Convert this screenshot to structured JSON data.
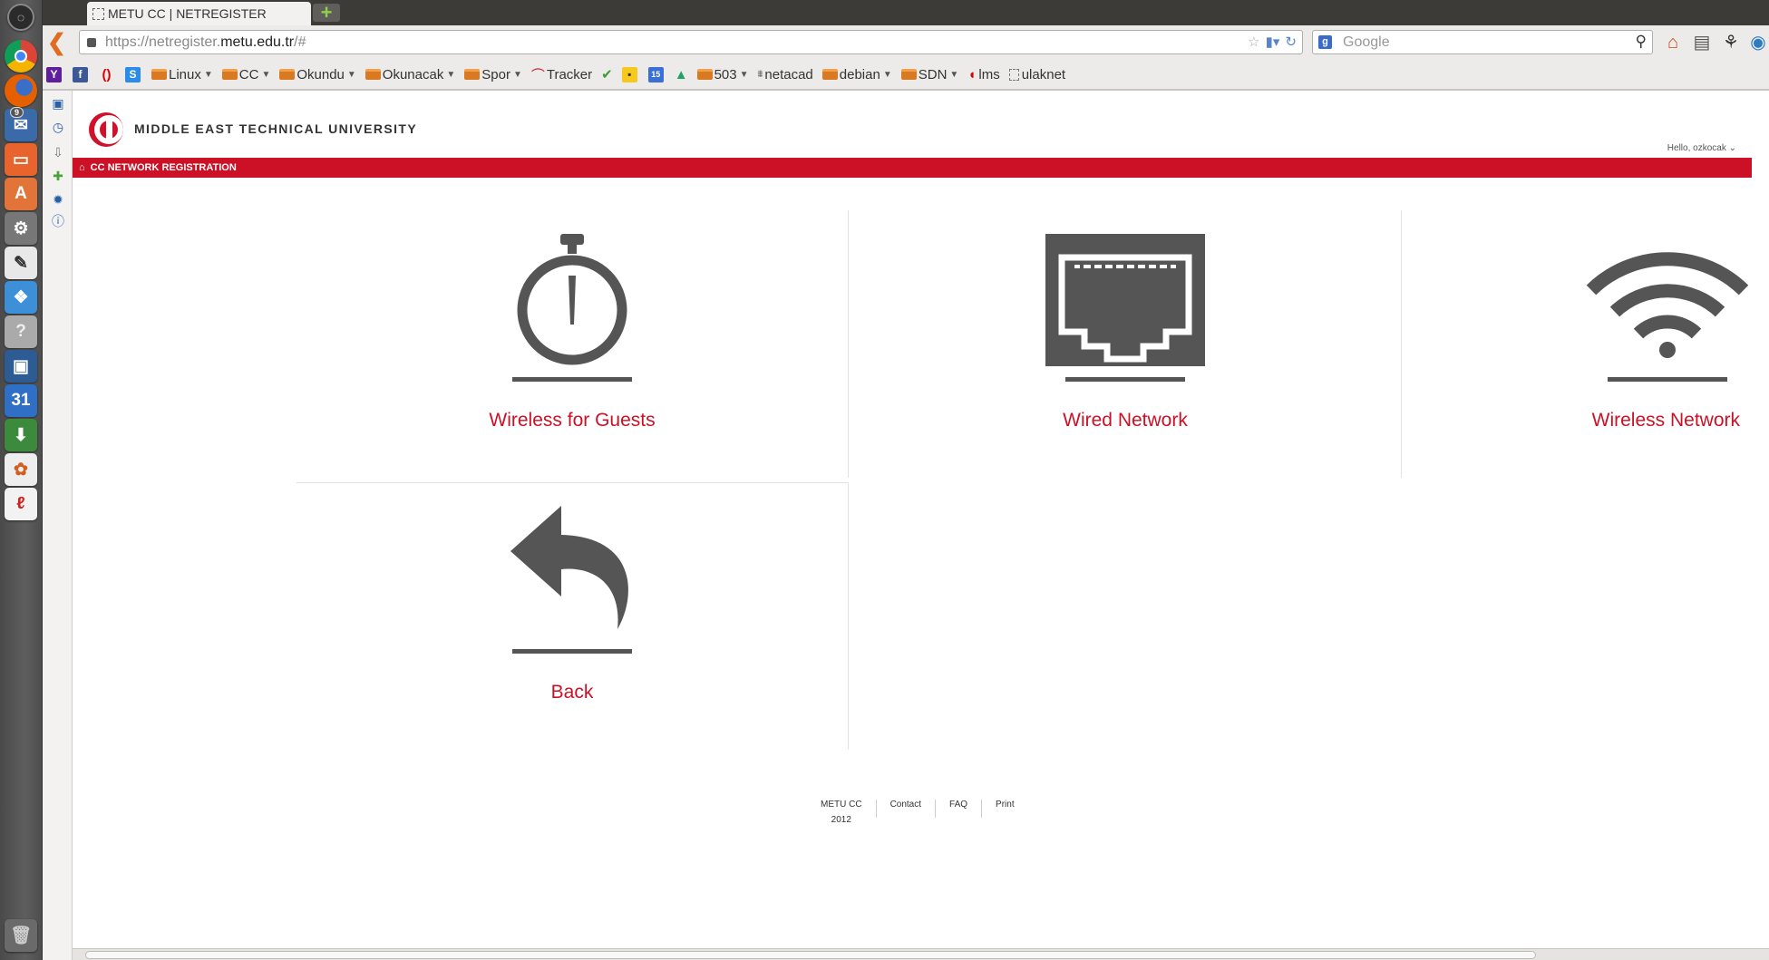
{
  "browser": {
    "tab_title": "METU CC | NETREGISTER",
    "url_prefix": "https://netregister.",
    "url_domain": "metu.edu.tr",
    "url_tail": "/#",
    "search_placeholder": "Google"
  },
  "bookmarks": [
    {
      "label": "Linux",
      "folder": true
    },
    {
      "label": "CC",
      "folder": true
    },
    {
      "label": "Okundu",
      "folder": true
    },
    {
      "label": "Okunacak",
      "folder": true
    },
    {
      "label": "Spor",
      "folder": true
    },
    {
      "label": "Tracker",
      "folder": false
    },
    {
      "label": "503",
      "folder": true
    },
    {
      "label": "netacad",
      "folder": false
    },
    {
      "label": "debian",
      "folder": true
    },
    {
      "label": "SDN",
      "folder": true
    },
    {
      "label": "lms",
      "folder": false
    },
    {
      "label": "ulaknet",
      "folder": false
    }
  ],
  "header": {
    "university": "MIDDLE EAST TECHNICAL UNIVERSITY",
    "greeting": "Hello, ozkocak",
    "breadcrumb": "CC NETWORK REGISTRATION"
  },
  "tiles": {
    "guests": "Wireless for Guests",
    "wired": "Wired Network",
    "wireless": "Wireless Network",
    "back": "Back"
  },
  "footer": {
    "org": "METU CC",
    "year": "2012",
    "contact": "Contact",
    "faq": "FAQ",
    "print": "Print"
  },
  "colors": {
    "brand_red": "#cc1126",
    "icon_grey": "#555555"
  },
  "launcher": {
    "calendar_day": "31",
    "notification_count": "9"
  }
}
